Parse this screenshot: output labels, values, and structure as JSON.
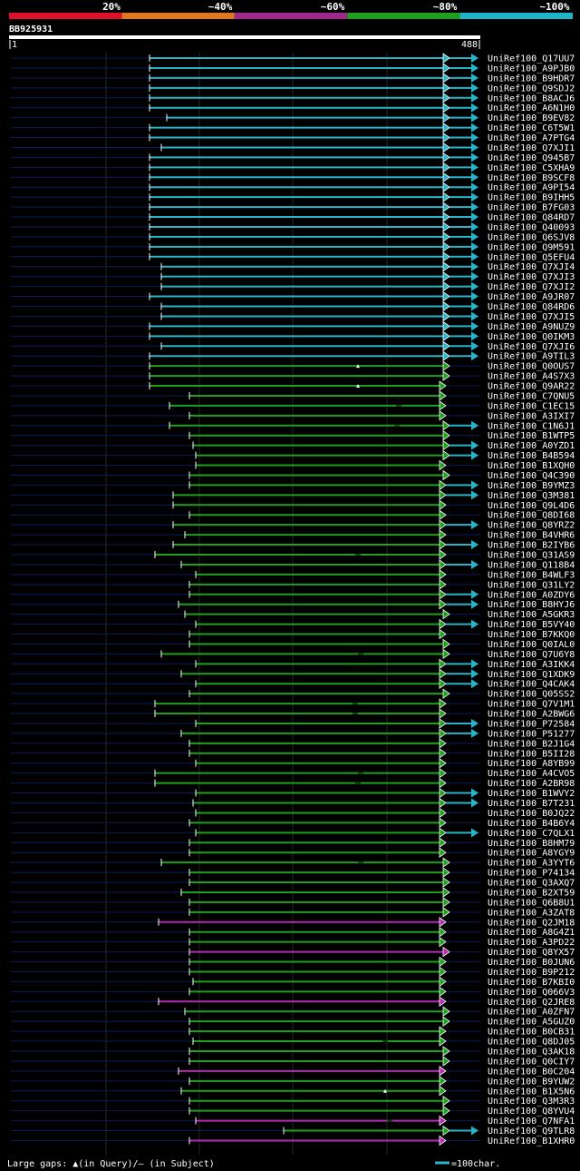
{
  "legend": {
    "scale_labels": [
      "20%",
      "~40%",
      "~60%",
      "~80%",
      "~100%"
    ],
    "scale_colors": [
      "#e0102a",
      "#e0761e",
      "#a0288c",
      "#1ea01e",
      "#1eb4c8"
    ],
    "footer_gaps": "Large gaps: ▲(in Query)/— (in Subject)",
    "footer_scale": "=100char."
  },
  "query": {
    "id": "BB925931",
    "start": "1",
    "end": "488"
  },
  "colors": {
    "purple": "#b42ab4",
    "green": "#1ea01e",
    "cyan": "#28b4c8",
    "navy": "#0a1a5a",
    "white": "#ffffff"
  },
  "hits": [
    {
      "id": "UniRef100_Q17UU7",
      "c": "cyan",
      "s": 165,
      "e": 490,
      "ext": true
    },
    {
      "id": "UniRef100_A9PJB0",
      "c": "cyan",
      "s": 165,
      "e": 490,
      "ext": true
    },
    {
      "id": "UniRef100_B9HDR7",
      "c": "cyan",
      "s": 165,
      "e": 490,
      "ext": true
    },
    {
      "id": "UniRef100_Q9SDJ2",
      "c": "cyan",
      "s": 165,
      "e": 490,
      "ext": true
    },
    {
      "id": "UniRef100_B8ACJ6",
      "c": "cyan",
      "s": 165,
      "e": 490,
      "ext": true
    },
    {
      "id": "UniRef100_A6N1H0",
      "c": "cyan",
      "s": 165,
      "e": 490,
      "ext": true
    },
    {
      "id": "UniRef100_B9EV82",
      "c": "cyan",
      "s": 184,
      "e": 490,
      "ext": true
    },
    {
      "id": "UniRef100_C6T5W1",
      "c": "cyan",
      "s": 165,
      "e": 490,
      "ext": true
    },
    {
      "id": "UniRef100_A7PTG4",
      "c": "cyan",
      "s": 165,
      "e": 490,
      "ext": true
    },
    {
      "id": "UniRef100_Q7XJI1",
      "c": "cyan",
      "s": 178,
      "e": 490,
      "ext": true
    },
    {
      "id": "UniRef100_Q945B7",
      "c": "cyan",
      "s": 165,
      "e": 490,
      "ext": true
    },
    {
      "id": "UniRef100_C5XHA9",
      "c": "cyan",
      "s": 165,
      "e": 490,
      "ext": true
    },
    {
      "id": "UniRef100_B9SCF8",
      "c": "cyan",
      "s": 165,
      "e": 490,
      "ext": true
    },
    {
      "id": "UniRef100_A9PI54",
      "c": "cyan",
      "s": 165,
      "e": 490,
      "ext": true
    },
    {
      "id": "UniRef100_B9IHH5",
      "c": "cyan",
      "s": 165,
      "e": 490,
      "ext": true
    },
    {
      "id": "UniRef100_B7FG03",
      "c": "cyan",
      "s": 165,
      "e": 490,
      "ext": true
    },
    {
      "id": "UniRef100_Q84RD7",
      "c": "cyan",
      "s": 165,
      "e": 490,
      "ext": true
    },
    {
      "id": "UniRef100_Q40093",
      "c": "cyan",
      "s": 165,
      "e": 490,
      "ext": true
    },
    {
      "id": "UniRef100_Q6SJV8",
      "c": "cyan",
      "s": 165,
      "e": 490,
      "ext": true
    },
    {
      "id": "UniRef100_Q9M591",
      "c": "cyan",
      "s": 165,
      "e": 490,
      "ext": true
    },
    {
      "id": "UniRef100_Q5EFU4",
      "c": "cyan",
      "s": 165,
      "e": 490,
      "ext": true
    },
    {
      "id": "UniRef100_Q7XJI4",
      "c": "cyan",
      "s": 178,
      "e": 490,
      "ext": true
    },
    {
      "id": "UniRef100_Q7XJI3",
      "c": "cyan",
      "s": 178,
      "e": 490,
      "ext": true
    },
    {
      "id": "UniRef100_Q7XJI2",
      "c": "cyan",
      "s": 178,
      "e": 490,
      "ext": true
    },
    {
      "id": "UniRef100_A9JR07",
      "c": "cyan",
      "s": 165,
      "e": 490,
      "ext": true
    },
    {
      "id": "UniRef100_Q84RD6",
      "c": "cyan",
      "s": 178,
      "e": 490,
      "ext": true
    },
    {
      "id": "UniRef100_Q7XJI5",
      "c": "cyan",
      "s": 178,
      "e": 490,
      "ext": true
    },
    {
      "id": "UniRef100_A9NUZ9",
      "c": "cyan",
      "s": 165,
      "e": 490,
      "ext": true
    },
    {
      "id": "UniRef100_Q0IKM3",
      "c": "cyan",
      "s": 165,
      "e": 490,
      "ext": true
    },
    {
      "id": "UniRef100_Q7XJI6",
      "c": "cyan",
      "s": 178,
      "e": 490,
      "ext": true
    },
    {
      "id": "UniRef100_A9TIL3",
      "c": "cyan",
      "s": 165,
      "e": 490,
      "ext": true
    },
    {
      "id": "UniRef100_Q0OUS7",
      "c": "green",
      "s": 165,
      "e": 490,
      "ext": false,
      "q": 395
    },
    {
      "id": "UniRef100_A4S7X3",
      "c": "green",
      "s": 165,
      "e": 490,
      "ext": false
    },
    {
      "id": "UniRef100_Q9AR22",
      "c": "green",
      "s": 165,
      "e": 486,
      "ext": false,
      "q": 395
    },
    {
      "id": "UniRef100_C7QNU5",
      "c": "green",
      "s": 209,
      "e": 486,
      "ext": false
    },
    {
      "id": "UniRef100_C1EC15",
      "c": "green",
      "s": 187,
      "e": 486,
      "ext": false,
      "sg": 440
    },
    {
      "id": "UniRef100_A3IXI7",
      "c": "green",
      "s": 209,
      "e": 486,
      "ext": false
    },
    {
      "id": "UniRef100_C1N6J1",
      "c": "green",
      "s": 187,
      "e": 490,
      "ext": true,
      "sg": 438
    },
    {
      "id": "UniRef100_B1WTP5",
      "c": "green",
      "s": 209,
      "e": 490,
      "ext": false
    },
    {
      "id": "UniRef100_A0YZD1",
      "c": "green",
      "s": 213,
      "e": 490,
      "ext": true
    },
    {
      "id": "UniRef100_B4B594",
      "c": "green",
      "s": 216,
      "e": 490,
      "ext": true
    },
    {
      "id": "UniRef100_B1XQH0",
      "c": "green",
      "s": 216,
      "e": 486,
      "ext": false
    },
    {
      "id": "UniRef100_Q4C390",
      "c": "green",
      "s": 209,
      "e": 490,
      "ext": false
    },
    {
      "id": "UniRef100_B9YMZ3",
      "c": "green",
      "s": 209,
      "e": 486,
      "ext": true
    },
    {
      "id": "UniRef100_Q3M381",
      "c": "green",
      "s": 191,
      "e": 486,
      "ext": true
    },
    {
      "id": "UniRef100_Q9L4D6",
      "c": "green",
      "s": 191,
      "e": 486,
      "ext": false
    },
    {
      "id": "UniRef100_Q8DI68",
      "c": "green",
      "s": 209,
      "e": 486,
      "ext": false
    },
    {
      "id": "UniRef100_Q8YRZ2",
      "c": "green",
      "s": 191,
      "e": 486,
      "ext": true
    },
    {
      "id": "UniRef100_B4VHR6",
      "c": "green",
      "s": 204,
      "e": 486,
      "ext": false
    },
    {
      "id": "UniRef100_B2IYB6",
      "c": "green",
      "s": 191,
      "e": 486,
      "ext": true
    },
    {
      "id": "UniRef100_Q31AS9",
      "c": "green",
      "s": 171,
      "e": 486,
      "ext": false,
      "sg": 395
    },
    {
      "id": "UniRef100_Q118B4",
      "c": "green",
      "s": 200,
      "e": 486,
      "ext": true
    },
    {
      "id": "UniRef100_B4WLF3",
      "c": "green",
      "s": 216,
      "e": 486,
      "ext": false
    },
    {
      "id": "UniRef100_Q31LY2",
      "c": "green",
      "s": 209,
      "e": 486,
      "ext": false
    },
    {
      "id": "UniRef100_A0ZDY6",
      "c": "green",
      "s": 209,
      "e": 486,
      "ext": true
    },
    {
      "id": "UniRef100_B8HYJ6",
      "c": "green",
      "s": 197,
      "e": 486,
      "ext": true
    },
    {
      "id": "UniRef100_A5GKR3",
      "c": "green",
      "s": 204,
      "e": 490,
      "ext": false
    },
    {
      "id": "UniRef100_B5VY40",
      "c": "green",
      "s": 216,
      "e": 486,
      "ext": true
    },
    {
      "id": "UniRef100_B7KKQ0",
      "c": "green",
      "s": 209,
      "e": 486,
      "ext": false
    },
    {
      "id": "UniRef100_Q0IAL0",
      "c": "green",
      "s": 209,
      "e": 490,
      "ext": false
    },
    {
      "id": "UniRef100_Q7U6Y8",
      "c": "green",
      "s": 178,
      "e": 490,
      "ext": false,
      "sg": 398
    },
    {
      "id": "UniRef100_A3IKK4",
      "c": "green",
      "s": 216,
      "e": 486,
      "ext": true
    },
    {
      "id": "UniRef100_Q1XDK9",
      "c": "green",
      "s": 200,
      "e": 486,
      "ext": true
    },
    {
      "id": "UniRef100_Q4CAK4",
      "c": "green",
      "s": 216,
      "e": 486,
      "ext": true
    },
    {
      "id": "UniRef100_Q05SS2",
      "c": "green",
      "s": 209,
      "e": 490,
      "ext": false
    },
    {
      "id": "UniRef100_Q7V1M1",
      "c": "green",
      "s": 171,
      "e": 486,
      "ext": false,
      "sg": 392
    },
    {
      "id": "UniRef100_A2BWG6",
      "c": "green",
      "s": 171,
      "e": 486,
      "ext": false,
      "sg": 392
    },
    {
      "id": "UniRef100_P72584",
      "c": "green",
      "s": 216,
      "e": 486,
      "ext": true
    },
    {
      "id": "UniRef100_P51277",
      "c": "green",
      "s": 200,
      "e": 486,
      "ext": true
    },
    {
      "id": "UniRef100_B2J1G4",
      "c": "green",
      "s": 209,
      "e": 486,
      "ext": false
    },
    {
      "id": "UniRef100_B5II28",
      "c": "green",
      "s": 209,
      "e": 486,
      "ext": false
    },
    {
      "id": "UniRef100_A8YB99",
      "c": "green",
      "s": 216,
      "e": 486,
      "ext": false
    },
    {
      "id": "UniRef100_A4CVO5",
      "c": "green",
      "s": 171,
      "e": 486,
      "ext": false,
      "sg": 398
    },
    {
      "id": "UniRef100_A2BR98",
      "c": "green",
      "s": 171,
      "e": 486,
      "ext": false,
      "sg": 395
    },
    {
      "id": "UniRef100_B1WVY2",
      "c": "green",
      "s": 216,
      "e": 486,
      "ext": true
    },
    {
      "id": "UniRef100_B7T231",
      "c": "green",
      "s": 213,
      "e": 486,
      "ext": true
    },
    {
      "id": "UniRef100_B0JQ22",
      "c": "green",
      "s": 216,
      "e": 486,
      "ext": false
    },
    {
      "id": "UniRef100_B4B6Y4",
      "c": "green",
      "s": 209,
      "e": 486,
      "ext": false
    },
    {
      "id": "UniRef100_C7QLX1",
      "c": "green",
      "s": 216,
      "e": 486,
      "ext": true
    },
    {
      "id": "UniRef100_B8HM79",
      "c": "green",
      "s": 209,
      "e": 486,
      "ext": false
    },
    {
      "id": "UniRef100_A8YGY9",
      "c": "green",
      "s": 209,
      "e": 486,
      "ext": false
    },
    {
      "id": "UniRef100_A3YYT6",
      "c": "green",
      "s": 178,
      "e": 490,
      "ext": false,
      "sg": 398
    },
    {
      "id": "UniRef100_P74134",
      "c": "green",
      "s": 209,
      "e": 490,
      "ext": false
    },
    {
      "id": "UniRef100_Q3AXQ7",
      "c": "green",
      "s": 209,
      "e": 490,
      "ext": false
    },
    {
      "id": "UniRef100_B2XT59",
      "c": "green",
      "s": 200,
      "e": 490,
      "ext": false
    },
    {
      "id": "UniRef100_Q6B8U1",
      "c": "green",
      "s": 209,
      "e": 490,
      "ext": false
    },
    {
      "id": "UniRef100_A3ZAT8",
      "c": "green",
      "s": 209,
      "e": 490,
      "ext": false
    },
    {
      "id": "UniRef100_Q2JM18",
      "c": "purple",
      "s": 175,
      "e": 486,
      "ext": false
    },
    {
      "id": "UniRef100_A8G4Z1",
      "c": "green",
      "s": 209,
      "e": 486,
      "ext": false
    },
    {
      "id": "UniRef100_A3PD22",
      "c": "green",
      "s": 209,
      "e": 486,
      "ext": false
    },
    {
      "id": "UniRef100_Q8YX57",
      "c": "purple",
      "s": 209,
      "e": 490,
      "ext": false
    },
    {
      "id": "UniRef100_B0JUN6",
      "c": "green",
      "s": 209,
      "e": 486,
      "ext": false
    },
    {
      "id": "UniRef100_B9P212",
      "c": "green",
      "s": 209,
      "e": 486,
      "ext": false
    },
    {
      "id": "UniRef100_B7KBI0",
      "c": "green",
      "s": 213,
      "e": 486,
      "ext": false
    },
    {
      "id": "UniRef100_Q066V3",
      "c": "green",
      "s": 209,
      "e": 486,
      "ext": false
    },
    {
      "id": "UniRef100_Q2JRE8",
      "c": "purple",
      "s": 175,
      "e": 486,
      "ext": false
    },
    {
      "id": "UniRef100_A0ZFN7",
      "c": "green",
      "s": 204,
      "e": 490,
      "ext": false
    },
    {
      "id": "UniRef100_A5GUZ0",
      "c": "green",
      "s": 209,
      "e": 490,
      "ext": false
    },
    {
      "id": "UniRef100_B0CB31",
      "c": "green",
      "s": 209,
      "e": 486,
      "ext": false
    },
    {
      "id": "UniRef100_Q8DJ05",
      "c": "green",
      "s": 213,
      "e": 486,
      "ext": false,
      "sg": 425
    },
    {
      "id": "UniRef100_Q3AK18",
      "c": "green",
      "s": 209,
      "e": 490,
      "ext": false
    },
    {
      "id": "UniRef100_Q0CIY7",
      "c": "green",
      "s": 209,
      "e": 490,
      "ext": false
    },
    {
      "id": "UniRef100_B0C204",
      "c": "purple",
      "s": 197,
      "e": 486,
      "ext": false
    },
    {
      "id": "UniRef100_B9YUW2",
      "c": "green",
      "s": 209,
      "e": 486,
      "ext": false
    },
    {
      "id": "UniRef100_B1X5N6",
      "c": "green",
      "s": 200,
      "e": 486,
      "ext": false,
      "q": 425
    },
    {
      "id": "UniRef100_Q3M3R3",
      "c": "green",
      "s": 209,
      "e": 490,
      "ext": false
    },
    {
      "id": "UniRef100_Q8YVU4",
      "c": "green",
      "s": 209,
      "e": 490,
      "ext": false
    },
    {
      "id": "UniRef100_Q7NFA1",
      "c": "purple",
      "s": 216,
      "e": 486,
      "ext": false,
      "sg": 430
    },
    {
      "id": "UniRef100_Q9TLR8",
      "c": "green",
      "s": 313,
      "e": 490,
      "ext": true
    },
    {
      "id": "UniRef100_B1XHR0",
      "c": "purple",
      "s": 209,
      "e": 486,
      "ext": false
    }
  ]
}
